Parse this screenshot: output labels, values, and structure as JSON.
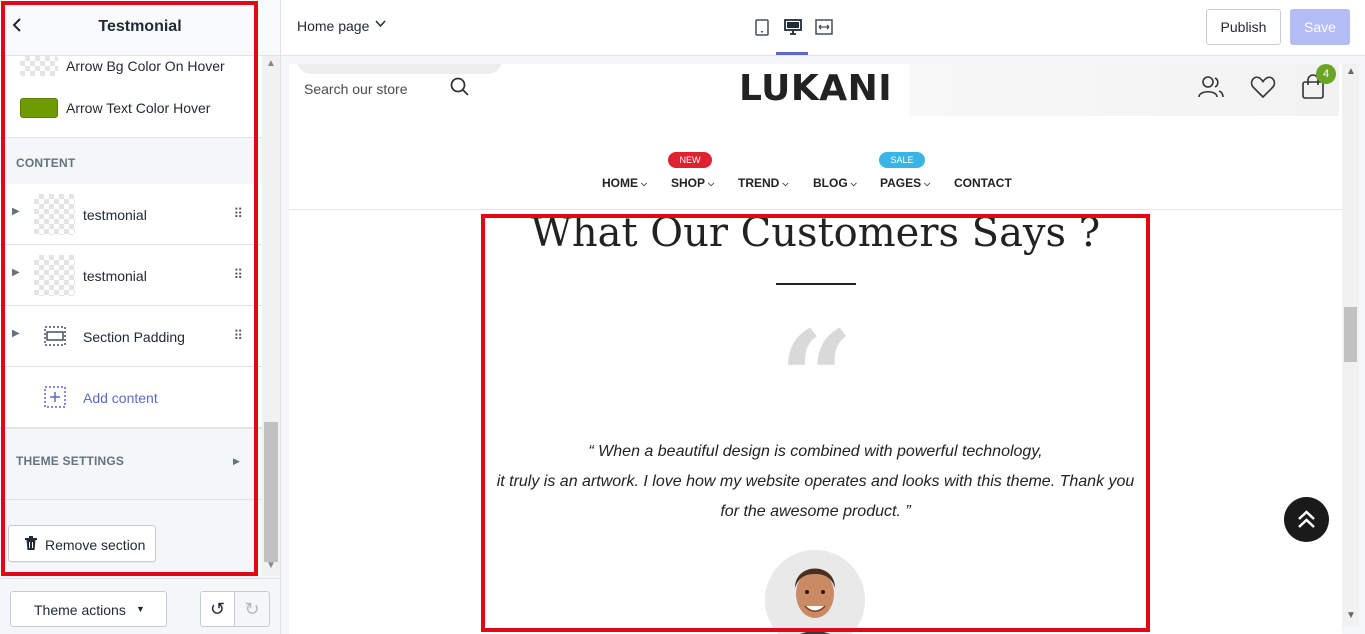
{
  "sidebar": {
    "title": "Testmonial",
    "color_settings": [
      {
        "label": "Arrow Bg Color On Hover",
        "swatch": "transparent"
      },
      {
        "label": "Arrow Text Color Hover",
        "swatch": "#6d9b00"
      }
    ],
    "content_heading": "CONTENT",
    "blocks": [
      {
        "label": "testmonial",
        "icon": "image-thumbnail"
      },
      {
        "label": "testmonial",
        "icon": "image-thumbnail"
      },
      {
        "label": "Section Padding",
        "icon": "section-padding-icon"
      }
    ],
    "add_content_label": "Add content",
    "theme_settings_heading": "THEME SETTINGS",
    "remove_section_label": "Remove section",
    "theme_actions_label": "Theme actions"
  },
  "topbar": {
    "page_select": "Home page",
    "devices": [
      "mobile-icon",
      "desktop-icon",
      "fullwidth-icon"
    ],
    "active_device": "desktop-icon",
    "publish_label": "Publish",
    "save_label": "Save"
  },
  "preview": {
    "search_placeholder": "Search our store",
    "logo": "LUKANI",
    "cart_count": "4",
    "nav": [
      {
        "label": "HOME",
        "caret": true
      },
      {
        "label": "SHOP",
        "caret": true,
        "badge": "NEW"
      },
      {
        "label": "TREND",
        "caret": true
      },
      {
        "label": "BLOG",
        "caret": true
      },
      {
        "label": "PAGES",
        "caret": true,
        "badge": "SALE"
      },
      {
        "label": "CONTACT",
        "caret": false
      }
    ],
    "testimonial": {
      "title": "What Our Customers Says ?",
      "quote_lines": [
        "“ When a beautiful design is combined with powerful technology,",
        "it truly is an artwork. I love how my website operates and looks with this theme. Thank you",
        "for the awesome product. ”"
      ]
    }
  },
  "colors": {
    "highlight": "#e30613",
    "accent": "#5c6ac4",
    "save_disabled": "#b3bcf5",
    "badge_new": "#e0212f",
    "badge_sale": "#3ab4e4",
    "cart_badge": "#6aa527"
  }
}
